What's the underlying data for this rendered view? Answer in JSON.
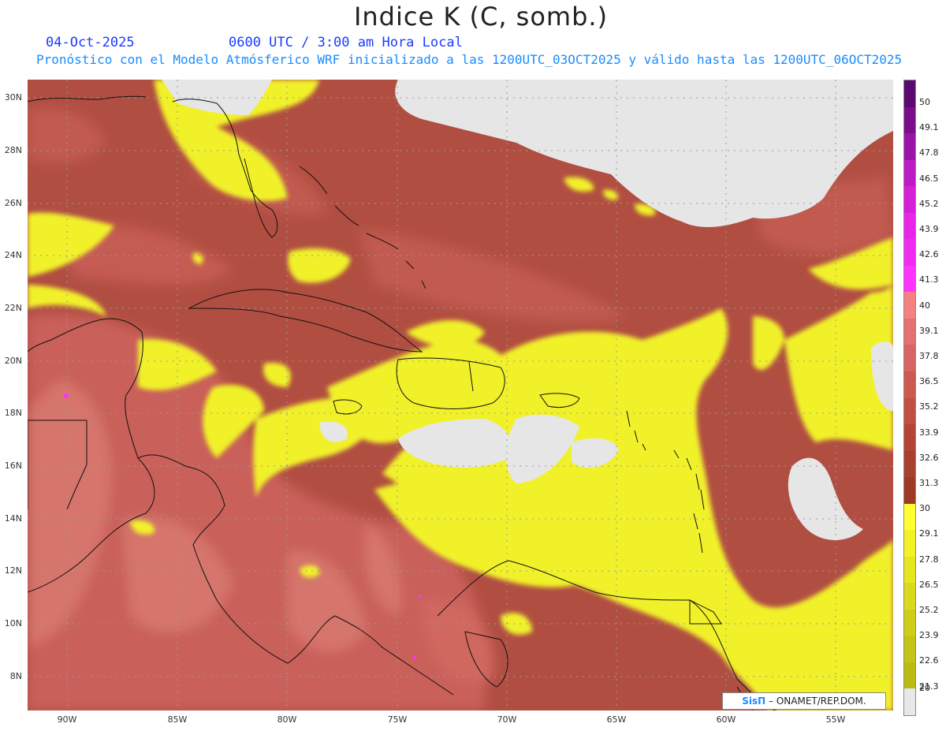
{
  "header": {
    "title": "Indice K (C, somb.)",
    "date": "04-Oct-2025",
    "utc_time": "0600 UTC / 3:00 am Hora Local",
    "forecast_line": "Pronóstico con el Modelo Atmósferico WRF inicializado a las 1200UTC_03OCT2025 y válido hasta las  1200UTC_06OCT2025"
  },
  "axes": {
    "lat_labels": [
      "30N",
      "28N",
      "26N",
      "24N",
      "22N",
      "20N",
      "18N",
      "16N",
      "14N",
      "12N",
      "10N",
      "8N"
    ],
    "lon_labels": [
      "90W",
      "85W",
      "80W",
      "75W",
      "70W",
      "65W",
      "60W",
      "55W"
    ]
  },
  "colorbar": {
    "labels": [
      "50",
      "49.1",
      "47.8",
      "46.5",
      "45.2",
      "43.9",
      "42.6",
      "41.3",
      "40",
      "39.1",
      "37.8",
      "36.5",
      "35.2",
      "33.9",
      "32.6",
      "31.3",
      "30",
      "29.1",
      "27.8",
      "26.5",
      "25.2",
      "23.9",
      "22.6",
      "21.3",
      "20"
    ],
    "colors": [
      "#5a0a6e",
      "#7a0e8a",
      "#9a14a8",
      "#bc1cc4",
      "#d61fd6",
      "#ea25ea",
      "#f02cf0",
      "#ff33ff",
      "#f48080",
      "#e57070",
      "#d86464",
      "#cc5a50",
      "#c05044",
      "#b44438",
      "#a8402e",
      "#9c3a26",
      "#ffff33",
      "#f2f224",
      "#e6e61e",
      "#dada1c",
      "#cece18",
      "#c4c416",
      "#baba12",
      "#e8e8e8"
    ]
  },
  "credit": {
    "brand": "SisΠ",
    "text": " – ONAMET/REP.DOM."
  },
  "colors": {
    "low": "#e8e8e8",
    "yellow": "#f0f02a",
    "brown": "#a4473a",
    "salmon": "#c96158",
    "pink": "#d8736a",
    "magenta": "#ff33ff"
  }
}
